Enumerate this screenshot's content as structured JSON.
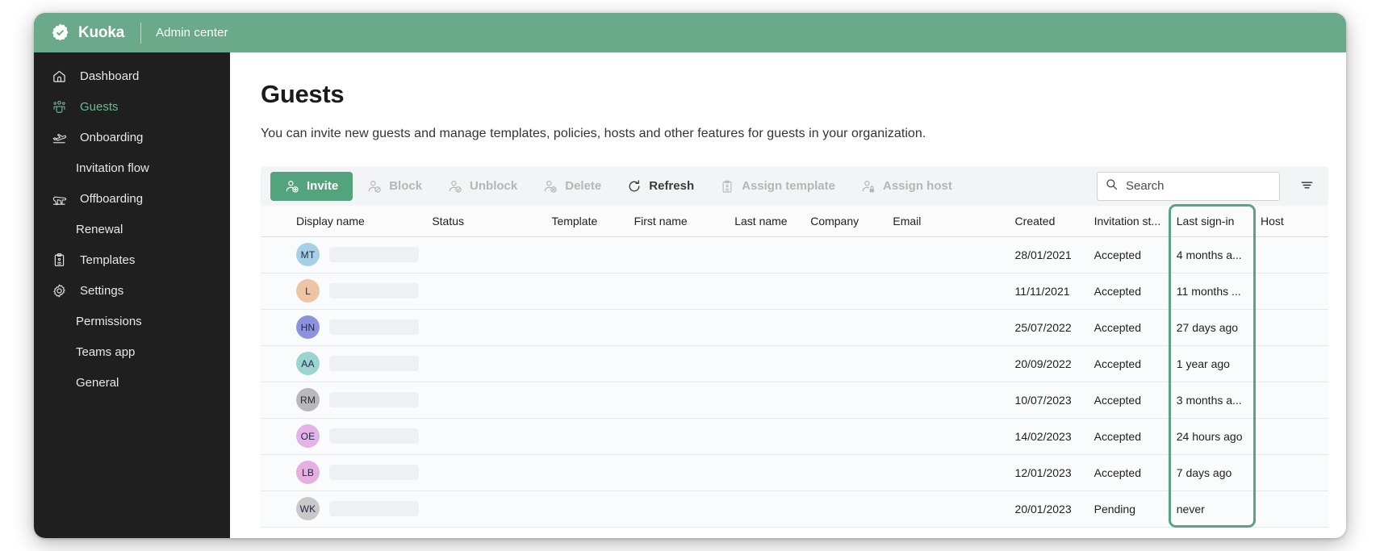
{
  "topbar": {
    "logo_icon": "verified-badge-icon",
    "brand": "Kuoka",
    "subtitle": "Admin center",
    "background": "#6aa989"
  },
  "sidebar": {
    "background": "#1f1f1f",
    "active_color": "#6fb894",
    "items": [
      {
        "label": "Dashboard",
        "icon": "home-icon",
        "active": false,
        "sub": false
      },
      {
        "label": "Guests",
        "icon": "people-team-icon",
        "active": true,
        "sub": false
      },
      {
        "label": "Onboarding",
        "icon": "plane-takeoff-icon",
        "active": false,
        "sub": false
      },
      {
        "label": "Invitation flow",
        "icon": "",
        "active": false,
        "sub": true
      },
      {
        "label": "Offboarding",
        "icon": "plane-landing-icon",
        "active": false,
        "sub": false
      },
      {
        "label": "Renewal",
        "icon": "",
        "active": false,
        "sub": true
      },
      {
        "label": "Templates",
        "icon": "clipboard-icon",
        "active": false,
        "sub": false
      },
      {
        "label": "Settings",
        "icon": "gear-icon",
        "active": false,
        "sub": false
      },
      {
        "label": "Permissions",
        "icon": "",
        "active": false,
        "sub": true
      },
      {
        "label": "Teams app",
        "icon": "",
        "active": false,
        "sub": true
      },
      {
        "label": "General",
        "icon": "",
        "active": false,
        "sub": true
      }
    ]
  },
  "page": {
    "title": "Guests",
    "description": "You can invite new guests and manage templates, policies, hosts and other features for guests in your organization."
  },
  "toolbar": {
    "primary_color": "#53a37d",
    "buttons": [
      {
        "label": "Invite",
        "icon": "person-add-icon",
        "state": "primary"
      },
      {
        "label": "Block",
        "icon": "person-block-icon",
        "state": "disabled"
      },
      {
        "label": "Unblock",
        "icon": "person-unblock-icon",
        "state": "disabled"
      },
      {
        "label": "Delete",
        "icon": "person-delete-icon",
        "state": "disabled"
      },
      {
        "label": "Refresh",
        "icon": "refresh-icon",
        "state": "enabled"
      },
      {
        "label": "Assign template",
        "icon": "clipboard-icon",
        "state": "disabled"
      },
      {
        "label": "Assign host",
        "icon": "person-lock-icon",
        "state": "disabled"
      }
    ],
    "search": {
      "placeholder": "Search",
      "value": "",
      "icon": "search-icon"
    },
    "filter": {
      "icon": "filter-icon"
    }
  },
  "table": {
    "highlighted_column": "Last sign-in",
    "highlight_color": "#5aa484",
    "columns": [
      "Display name",
      "Status",
      "Template",
      "First name",
      "Last name",
      "Company",
      "Email",
      "Created",
      "Invitation st...",
      "Last sign-in",
      "Host"
    ],
    "rows": [
      {
        "initials": "MT",
        "avatar_color": "#a8cfe8",
        "status": "",
        "template": "",
        "created": "28/01/2021",
        "invitation_status": "Accepted",
        "last_sign_in": "4 months a...",
        "host": ""
      },
      {
        "initials": "L",
        "avatar_color": "#eec5a4",
        "status": "",
        "template": "",
        "created": "11/11/2021",
        "invitation_status": "Accepted",
        "last_sign_in": "11 months ...",
        "host": ""
      },
      {
        "initials": "HN",
        "avatar_color": "#8e92dd",
        "status": "",
        "template": "",
        "created": "25/07/2022",
        "invitation_status": "Accepted",
        "last_sign_in": "27 days ago",
        "host": ""
      },
      {
        "initials": "AA",
        "avatar_color": "#9ad6cf",
        "status": "",
        "template": "",
        "created": "20/09/2022",
        "invitation_status": "Accepted",
        "last_sign_in": "1 year ago",
        "host": ""
      },
      {
        "initials": "RM",
        "avatar_color": "#b9b9b9",
        "status": "",
        "template": "",
        "created": "10/07/2023",
        "invitation_status": "Accepted",
        "last_sign_in": "3 months a...",
        "host": ""
      },
      {
        "initials": "OE",
        "avatar_color": "#e3b3e8",
        "status": "",
        "template": "",
        "created": "14/02/2023",
        "invitation_status": "Accepted",
        "last_sign_in": "24 hours ago",
        "host": ""
      },
      {
        "initials": "LB",
        "avatar_color": "#e4b0e2",
        "status": "",
        "template": "",
        "created": "12/01/2023",
        "invitation_status": "Accepted",
        "last_sign_in": "7 days ago",
        "host": ""
      },
      {
        "initials": "WK",
        "avatar_color": "#c9c9c9",
        "status": "",
        "template": "",
        "created": "20/01/2023",
        "invitation_status": "Pending",
        "last_sign_in": "never",
        "host": ""
      }
    ]
  }
}
